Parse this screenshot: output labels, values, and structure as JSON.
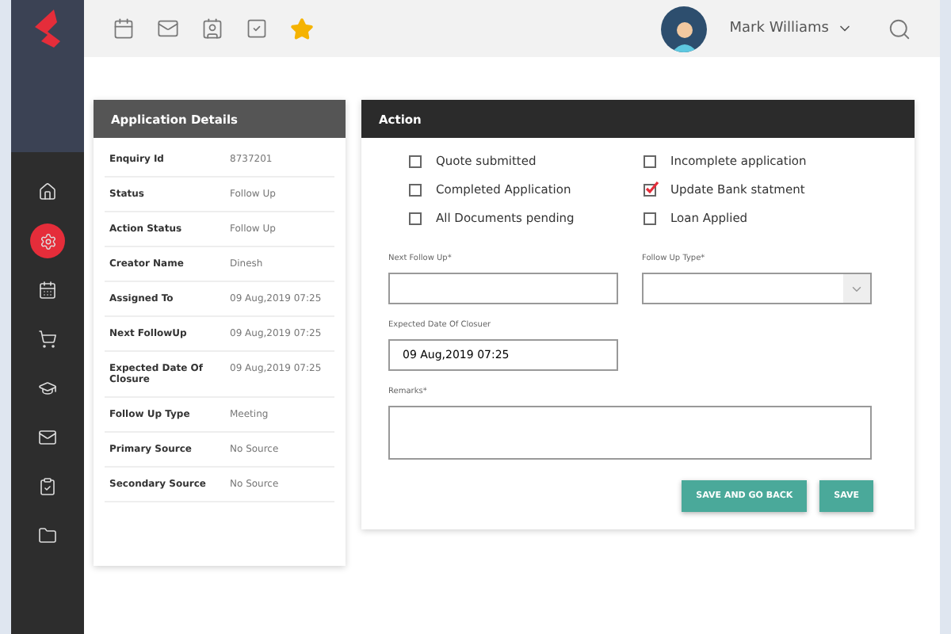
{
  "sidebar": {
    "items": [
      {
        "selected": false
      },
      {
        "selected": true
      },
      {
        "selected": false
      },
      {
        "selected": false
      },
      {
        "selected": false
      },
      {
        "selected": false
      },
      {
        "selected": false
      },
      {
        "selected": false
      }
    ]
  },
  "topbar": {
    "user_name": "Mark Williams"
  },
  "details": {
    "title": "Application Details",
    "rows": [
      {
        "label": "Enquiry Id",
        "value": "8737201"
      },
      {
        "label": "Status",
        "value": "Follow Up"
      },
      {
        "label": "Action Status",
        "value": "Follow Up"
      },
      {
        "label": "Creator Name",
        "value": "Dinesh"
      },
      {
        "label": "Assigned To",
        "value": "09 Aug,2019 07:25"
      },
      {
        "label": "Next FollowUp",
        "value": "09 Aug,2019 07:25"
      },
      {
        "label": "Expected Date Of Closure",
        "value": "09 Aug,2019 07:25"
      },
      {
        "label": "Follow Up Type",
        "value": "Meeting"
      },
      {
        "label": "Primary Source",
        "value": "No Source"
      },
      {
        "label": "Secondary Source",
        "value": "No Source"
      }
    ]
  },
  "action": {
    "title": "Action",
    "checkboxes": [
      {
        "label": "Quote submitted",
        "checked": false
      },
      {
        "label": "Incomplete application",
        "checked": false
      },
      {
        "label": "Completed Application",
        "checked": false
      },
      {
        "label": "Update Bank statment",
        "checked": true
      },
      {
        "label": "All Documents pending",
        "checked": false
      },
      {
        "label": "Loan Applied",
        "checked": false
      }
    ],
    "fields": [
      {
        "kind": "input",
        "label": "Next Follow Up*"
      },
      {
        "kind": "select",
        "label": "Follow Up Type*"
      },
      {
        "kind": "input",
        "label": "Expected Date Of Closuer",
        "value": "09 Aug,2019 07:25"
      },
      {
        "kind": "textarea",
        "label": "Remarks*"
      }
    ],
    "buttons": [
      "SAVE AND GO BACK",
      "SAVE"
    ]
  }
}
